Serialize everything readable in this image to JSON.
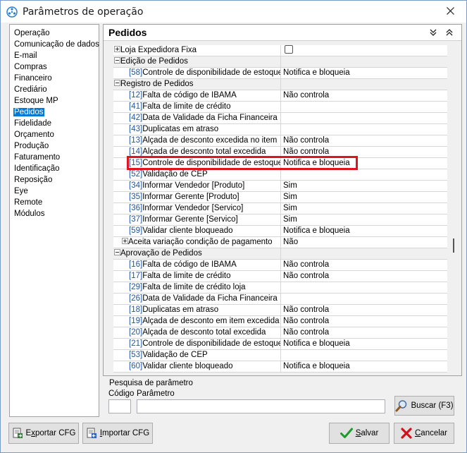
{
  "window": {
    "title": "Parâmetros de operação"
  },
  "sidebar": {
    "items": [
      {
        "label": "Operação"
      },
      {
        "label": "Comunicação de dados"
      },
      {
        "label": "E-mail"
      },
      {
        "label": "Compras"
      },
      {
        "label": "Financeiro"
      },
      {
        "label": "Crediário"
      },
      {
        "label": "Estoque MP"
      },
      {
        "label": "Pedidos",
        "selected": true
      },
      {
        "label": "Fidelidade"
      },
      {
        "label": "Orçamento"
      },
      {
        "label": "Produção"
      },
      {
        "label": "Faturamento"
      },
      {
        "label": "Identificação"
      },
      {
        "label": "Reposição"
      },
      {
        "label": "Eye"
      },
      {
        "label": "Remote"
      },
      {
        "label": "Módulos"
      }
    ]
  },
  "panel": {
    "title": "Pedidos"
  },
  "grid": {
    "rows": [
      {
        "type": "group",
        "expand": "plus",
        "label": "Loja Expedidora Fixa",
        "value": "",
        "checkbox": true
      },
      {
        "type": "category",
        "expand": "minus",
        "label": "Edição de Pedidos",
        "value": ""
      },
      {
        "type": "param",
        "code": "[58]",
        "label": "Controle de disponibilidade de estoque",
        "value": "Notifica e bloqueia"
      },
      {
        "type": "category",
        "expand": "minus",
        "label": "Registro de Pedidos",
        "value": ""
      },
      {
        "type": "param",
        "code": "[12]",
        "label": "Falta de código de IBAMA",
        "value": "Não controla"
      },
      {
        "type": "param",
        "code": "[41]",
        "label": "Falta de limite de crédito",
        "value": ""
      },
      {
        "type": "param",
        "code": "[42]",
        "label": "Data de Validade da Ficha Financeira",
        "value": ""
      },
      {
        "type": "param",
        "code": "[43]",
        "label": "Duplicatas em atraso",
        "value": ""
      },
      {
        "type": "param",
        "code": "[13]",
        "label": "Alçada de desconto excedida no item",
        "value": "Não controla"
      },
      {
        "type": "param",
        "code": "[14]",
        "label": "Alçada de desconto total excedida",
        "value": "Não controla"
      },
      {
        "type": "param",
        "code": "[15]",
        "label": "Controle de disponibilidade de estoque",
        "value": "Notifica e bloqueia"
      },
      {
        "type": "param",
        "code": "[52]",
        "label": "Validação de CEP",
        "value": ""
      },
      {
        "type": "param",
        "code": "[34]",
        "label": "Informar Vendedor [Produto]",
        "value": "Sim"
      },
      {
        "type": "param",
        "code": "[35]",
        "label": "Informar Gerente [Produto]",
        "value": "Sim"
      },
      {
        "type": "param",
        "code": "[36]",
        "label": "Informar Vendedor [Servico]",
        "value": "Sim"
      },
      {
        "type": "param",
        "code": "[37]",
        "label": "Informar Gerente [Servico]",
        "value": "Sim"
      },
      {
        "type": "param",
        "code": "[59]",
        "label": "Validar cliente bloqueado",
        "value": "Notifica e bloqueia"
      },
      {
        "type": "subgroup",
        "expand": "plus",
        "label": "Aceita variação condição de pagamento",
        "value": "Não"
      },
      {
        "type": "category",
        "expand": "minus",
        "label": "Aprovação de Pedidos",
        "value": ""
      },
      {
        "type": "param",
        "code": "[16]",
        "label": "Falta de código de IBAMA",
        "value": "Não controla"
      },
      {
        "type": "param",
        "code": "[17]",
        "label": "Falta de limite de crédito",
        "value": "Não controla"
      },
      {
        "type": "param",
        "code": "[29]",
        "label": "Falta de limite de crédito loja",
        "value": ""
      },
      {
        "type": "param",
        "code": "[26]",
        "label": "Data de Validade da Ficha Financeira",
        "value": ""
      },
      {
        "type": "param",
        "code": "[18]",
        "label": "Duplicatas em atraso",
        "value": "Não controla"
      },
      {
        "type": "param",
        "code": "[19]",
        "label": "Alçada de desconto em item excedida",
        "value": "Não controla"
      },
      {
        "type": "param",
        "code": "[20]",
        "label": "Alçada de desconto total excedida",
        "value": "Não controla"
      },
      {
        "type": "param",
        "code": "[21]",
        "label": "Controle de disponibilidade de estoque",
        "value": "Notifica e bloqueia"
      },
      {
        "type": "param",
        "code": "[53]",
        "label": "Validação de CEP",
        "value": ""
      },
      {
        "type": "param",
        "code": "[60]",
        "label": "Validar cliente bloqueado",
        "value": "Notifica e bloqueia"
      }
    ]
  },
  "search": {
    "title": "Pesquisa de parâmetro",
    "code_label": "Código",
    "param_label": "Parâmetro",
    "code_value": "",
    "param_value": "",
    "button_label": "Buscar (F3)"
  },
  "footer": {
    "export_pre": "E",
    "export_u": "x",
    "export_post": "portar CFG",
    "import_pre": "",
    "import_u": "I",
    "import_post": "mportar CFG",
    "save_pre": "",
    "save_u": "S",
    "save_post": "alvar",
    "cancel_pre": "",
    "cancel_u": "C",
    "cancel_post": "ancelar"
  },
  "colors": {
    "selection": "#0078d7",
    "highlight": "#e0141e",
    "code_link": "#1f56a8"
  }
}
